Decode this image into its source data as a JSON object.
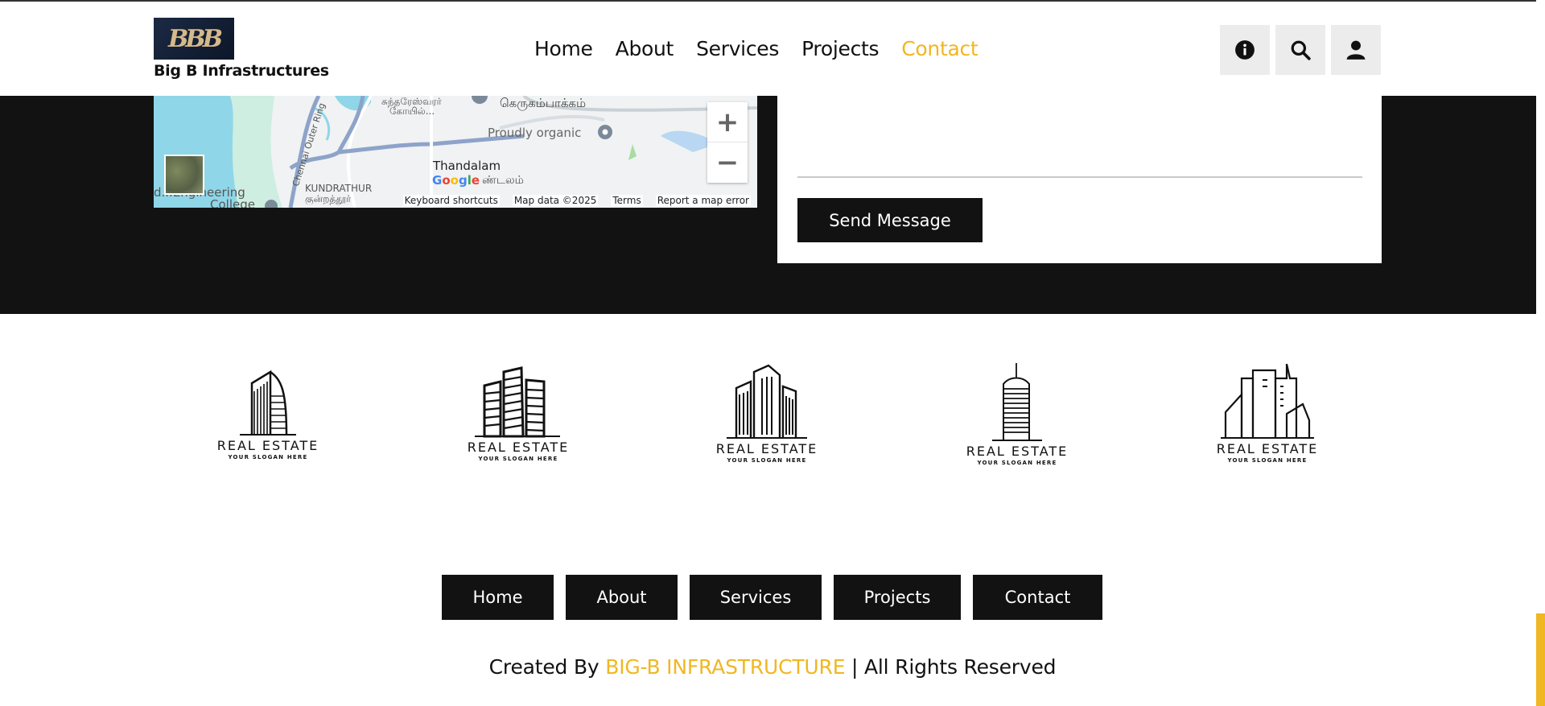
{
  "header": {
    "logo_text": "BBB",
    "brand_name": "Big B Infrastructures",
    "nav": [
      {
        "label": "Home",
        "active": false
      },
      {
        "label": "About",
        "active": false
      },
      {
        "label": "Services",
        "active": false
      },
      {
        "label": "Projects",
        "active": false
      },
      {
        "label": "Contact",
        "active": true
      }
    ],
    "icons": [
      "info-icon",
      "search-icon",
      "user-icon"
    ]
  },
  "map": {
    "labels": {
      "temple": "சுந்தரேஸ்வரர்",
      "temple2": "கோயில்...",
      "locality": "கெருகம்பாக்கம்",
      "poi": "Proudly organic",
      "thandalam": "Thandalam",
      "thandalam_ta": "ண்டலம்",
      "kundrathur": "KUNDRATHUR",
      "kundrathur_ta": "குன்றத்தூர்",
      "college": "d...Engineering",
      "college2": "College",
      "road": "Chennai Outer Ring"
    },
    "footer": [
      "Keyboard shortcuts",
      "Map data ©2025",
      "Terms",
      "Report a map error"
    ],
    "zoom_in": "+",
    "zoom_out": "−",
    "google_text": "Google"
  },
  "form": {
    "send_label": "Send Message"
  },
  "logos": [
    {
      "title": "REAL ESTATE",
      "slogan": "YOUR SLOGAN HERE"
    },
    {
      "title": "REAL ESTATE",
      "slogan": "YOUR SLOGAN HERE"
    },
    {
      "title": "REAL ESTATE",
      "slogan": "YOUR SLOGAN HERE"
    },
    {
      "title": "REAL ESTATE",
      "slogan": "YOUR SLOGAN HERE"
    },
    {
      "title": "REAL ESTATE",
      "slogan": "YOUR SLOGAN HERE"
    }
  ],
  "footer": {
    "nav": [
      "Home",
      "About",
      "Services",
      "Projects",
      "Contact"
    ],
    "copyright_prefix": "Created By ",
    "copyright_brand": "BIG-B INFRASTRUCTURE",
    "copyright_suffix": " | All Rights Reserved"
  },
  "colors": {
    "accent": "#f0b722",
    "dark": "#121212"
  }
}
